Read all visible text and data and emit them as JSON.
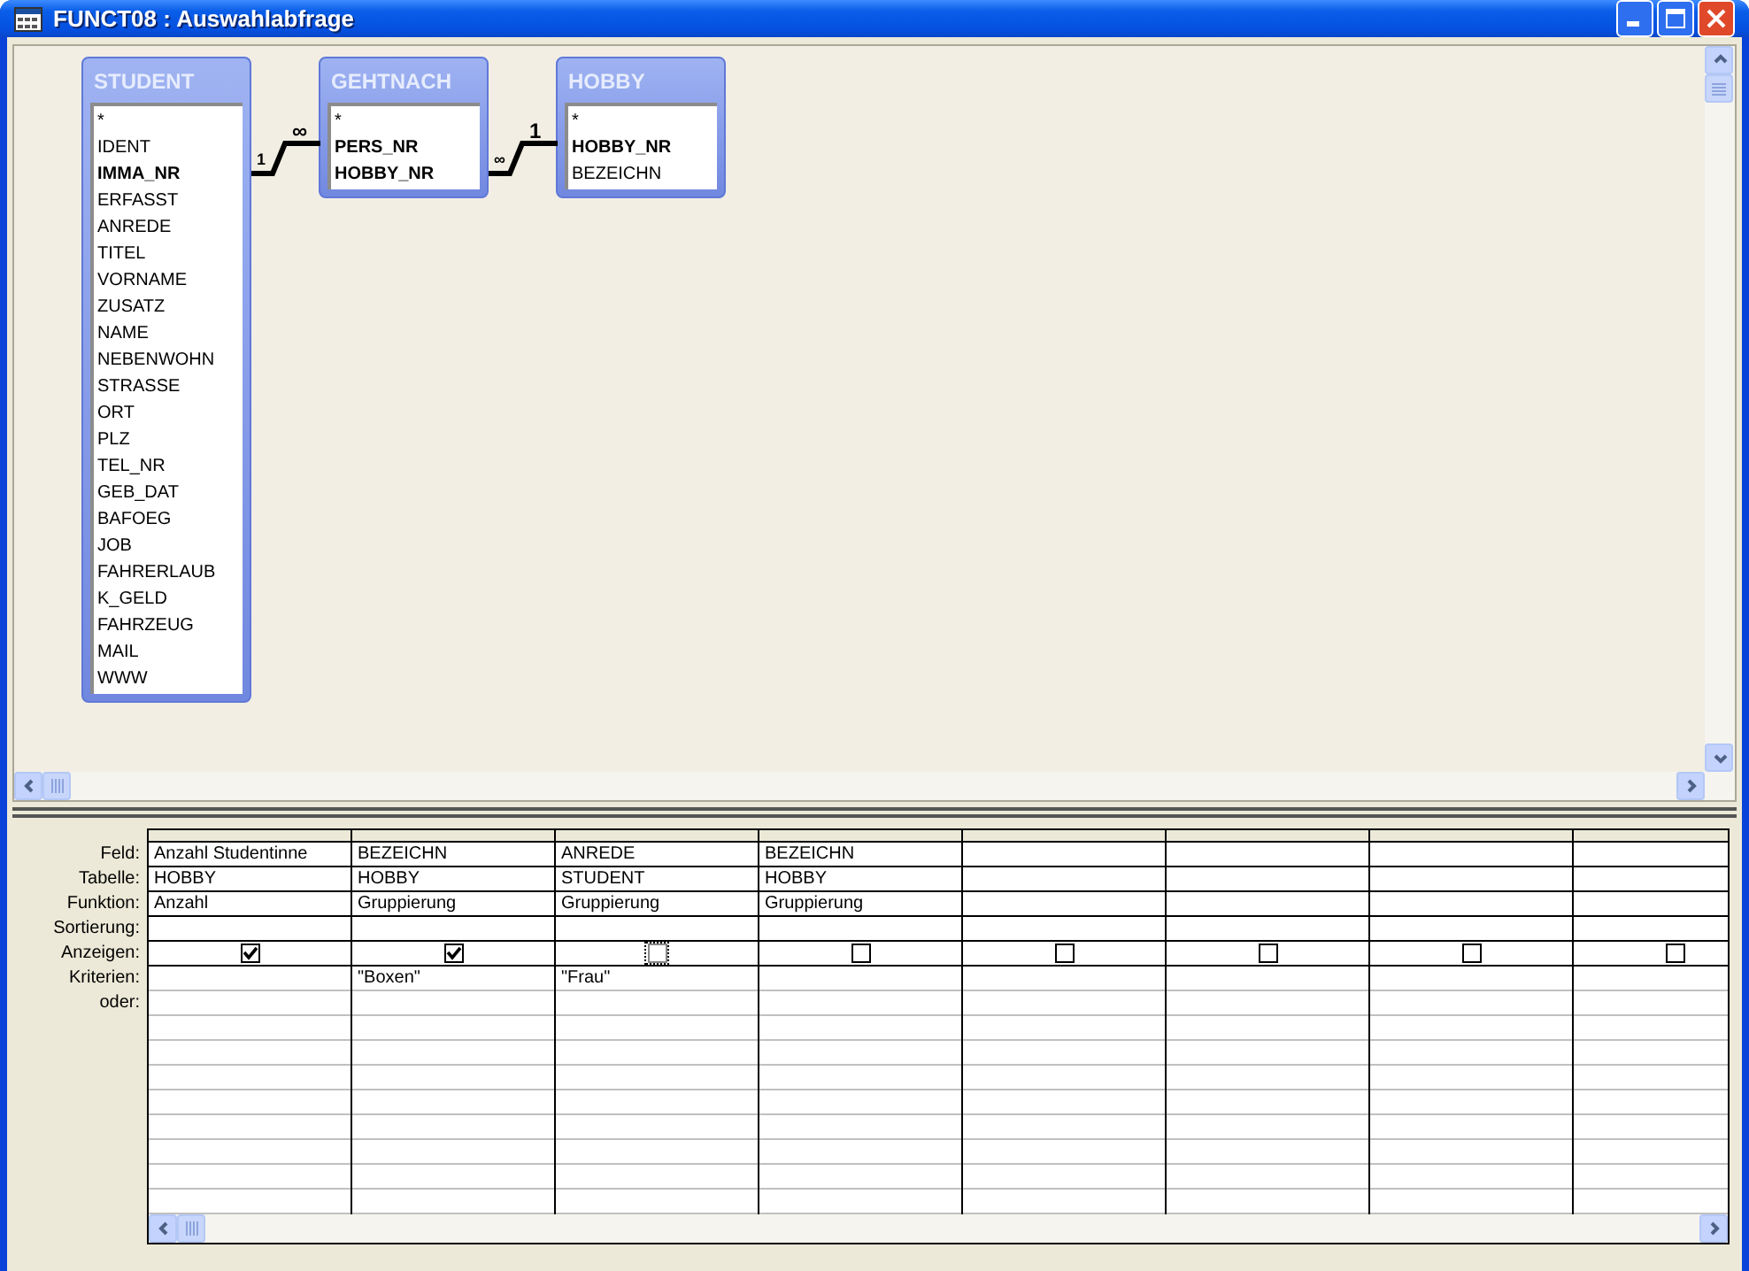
{
  "window": {
    "title": "FUNCT08 : Auswahlabfrage"
  },
  "tables": [
    {
      "name": "STUDENT",
      "fields": [
        {
          "name": "*",
          "key": false
        },
        {
          "name": "IDENT",
          "key": false
        },
        {
          "name": "IMMA_NR",
          "key": true
        },
        {
          "name": "ERFASST",
          "key": false
        },
        {
          "name": "ANREDE",
          "key": false
        },
        {
          "name": "TITEL",
          "key": false
        },
        {
          "name": "VORNAME",
          "key": false
        },
        {
          "name": "ZUSATZ",
          "key": false
        },
        {
          "name": "NAME",
          "key": false
        },
        {
          "name": "NEBENWOHN",
          "key": false
        },
        {
          "name": "STRASSE",
          "key": false
        },
        {
          "name": "ORT",
          "key": false
        },
        {
          "name": "PLZ",
          "key": false
        },
        {
          "name": "TEL_NR",
          "key": false
        },
        {
          "name": "GEB_DAT",
          "key": false
        },
        {
          "name": "BAFOEG",
          "key": false
        },
        {
          "name": "JOB",
          "key": false
        },
        {
          "name": "FAHRERLAUB",
          "key": false
        },
        {
          "name": "K_GELD",
          "key": false
        },
        {
          "name": "FAHRZEUG",
          "key": false
        },
        {
          "name": "MAIL",
          "key": false
        },
        {
          "name": "WWW",
          "key": false
        }
      ]
    },
    {
      "name": "GEHTNACH",
      "fields": [
        {
          "name": "*",
          "key": false
        },
        {
          "name": "PERS_NR",
          "key": true
        },
        {
          "name": "HOBBY_NR",
          "key": true
        }
      ]
    },
    {
      "name": "HOBBY",
      "fields": [
        {
          "name": "*",
          "key": false
        },
        {
          "name": "HOBBY_NR",
          "key": true
        },
        {
          "name": "BEZEICHN",
          "key": false
        }
      ]
    }
  ],
  "joins": [
    {
      "left_label": "1",
      "right_label": "∞"
    },
    {
      "left_label": "∞",
      "right_label": "1"
    }
  ],
  "row_labels": [
    "Feld:",
    "Tabelle:",
    "Funktion:",
    "Sortierung:",
    "Anzeigen:",
    "Kriterien:",
    "oder:"
  ],
  "columns": [
    {
      "field": "Anzahl Studentinne",
      "table": "HOBBY",
      "function": "Anzahl",
      "show": true,
      "focused": false
    },
    {
      "field": "BEZEICHN",
      "table": "HOBBY",
      "function": "Gruppierung",
      "show": true,
      "focused": false,
      "criteria": "\"Boxen\""
    },
    {
      "field": "ANREDE",
      "table": "STUDENT",
      "function": "Gruppierung",
      "show": false,
      "focused": true,
      "criteria": "\"Frau\""
    },
    {
      "field": "BEZEICHN",
      "table": "HOBBY",
      "function": "Gruppierung",
      "show": false,
      "focused": false
    },
    {
      "show": false,
      "focused": false
    },
    {
      "show": false,
      "focused": false
    },
    {
      "show": false,
      "focused": false
    },
    {
      "show": false,
      "focused": false
    }
  ]
}
